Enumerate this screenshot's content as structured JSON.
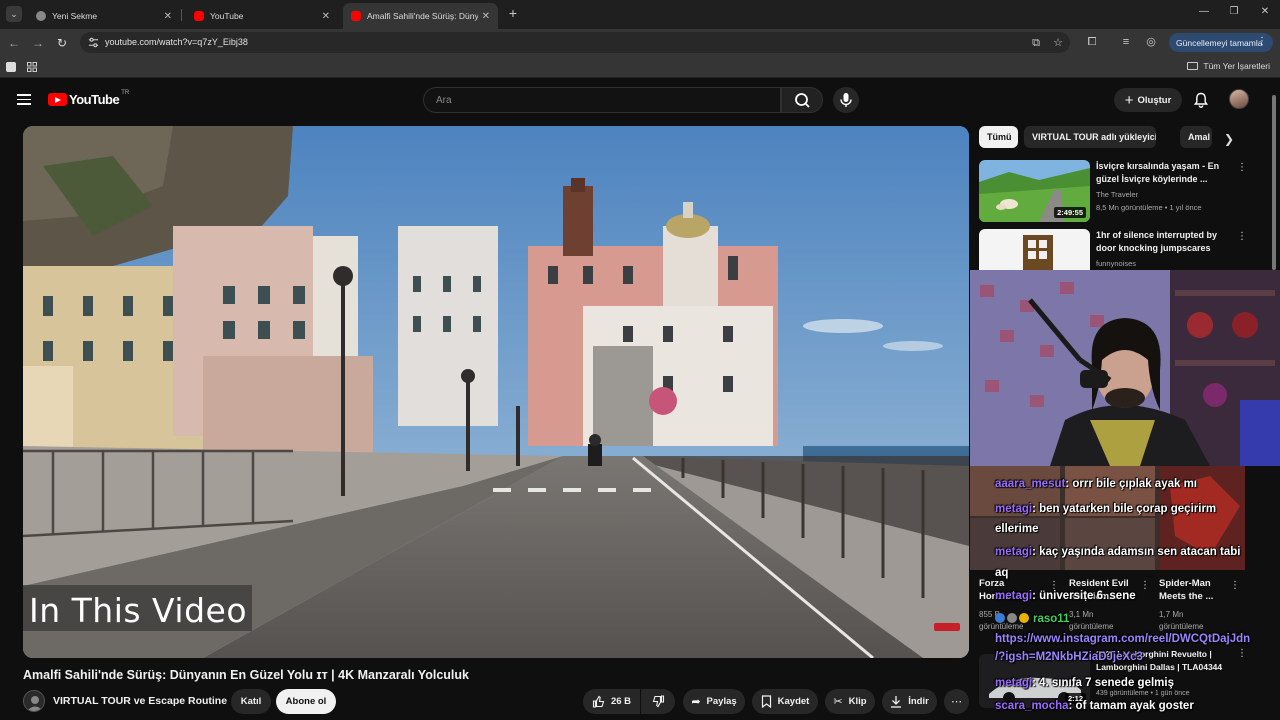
{
  "browser": {
    "tabs": [
      {
        "title": "Yeni Sekme",
        "active": false
      },
      {
        "title": "YouTube",
        "active": false
      },
      {
        "title": "Amalfi Sahili'nde Sürüş: Dünyan",
        "active": true
      }
    ],
    "url": "youtube.com/watch?v=q7zY_Eibj38",
    "update_button": "Güncellemeyi tamamla",
    "all_bookmarks": "Tüm Yer İşaretleri"
  },
  "yt_header": {
    "logo_text": "YouTube",
    "country_code": "TR",
    "search_placeholder": "Ara",
    "create_label": "Oluştur"
  },
  "player": {
    "overlay_text": "In This Video"
  },
  "video": {
    "title": "Amalfi Sahili'nde Sürüş: Dünyanın En Güzel Yolu ɪᴛ | 4K Manzaralı Yolculuk",
    "channel": "VIRTUAL TOUR ve Escape Routine",
    "join_label": "Katıl",
    "subscribe_label": "Abone ol",
    "like_count": "26 B",
    "share_label": "Paylaş",
    "save_label": "Kaydet",
    "clip_label": "Klip",
    "download_label": "İndir"
  },
  "sidebar": {
    "chips": [
      "Tümü",
      "VIRTUAL TOUR adlı yükleyiciden",
      "Amal"
    ],
    "recommendations": [
      {
        "title": "İsviçre kırsalında yaşam - En güzel İsviçre köylerinde ...",
        "channel": "The Traveler",
        "meta": "8,5 Mn görüntüleme • 1 yıl önce",
        "duration": "2:49:55"
      },
      {
        "title": "1hr of silence interrupted by door knocking jumpscares",
        "channel": "funnynoises",
        "meta": "",
        "duration": ""
      }
    ],
    "shorts": [
      {
        "title": "Forza Horiz...",
        "meta1": "855 B",
        "meta2": "görüntüleme"
      },
      {
        "title": "Resident Evil Requiem...",
        "meta1": "3,1 Mn",
        "meta2": "görüntüleme"
      },
      {
        "title": "Spider-Man Meets the ...",
        "meta1": "1,7 Mn",
        "meta2": "görüntüleme"
      }
    ],
    "bottom_rec": {
      "title": "2026 Lamborghini Revuelto | Lamborghini Dallas | TLA04344",
      "meta": "439 görüntüleme • 1 gün önce",
      "duration": "2:12"
    }
  },
  "stream_chat": [
    {
      "user": "aaara_mesut",
      "text": ": orrr bile çıplak ayak mı"
    },
    {
      "user": "metagi",
      "text": ": ben yatarken bile çorap geçirirm"
    },
    {
      "user": "",
      "text": "ellerime"
    },
    {
      "user": "metagi",
      "text": ": kaç yaşında adamsın sen atacan tabi"
    },
    {
      "user": "",
      "text": "aq"
    },
    {
      "user": "metagi",
      "text": ": üniversite 6. sene"
    },
    {
      "user": "",
      "text": "raso11"
    },
    {
      "user": "",
      "text": "https://www.instagram.com/reel/DWCQtDajJdn"
    },
    {
      "user": "",
      "text": "/?igsh=M2NkbHZiaDJjeXc3"
    },
    {
      "user": "metagi",
      "text": ": 4. sınıfa 7 senede gelmiş"
    },
    {
      "user": "scara_mocha",
      "text": ": of tamam ayak goster"
    }
  ],
  "colors": {
    "bg": "#0f0f0f",
    "chip": "#272727",
    "yt_red": "#ff0000",
    "chat_user": "#9b6bff",
    "update_btn": "#2d4a70"
  }
}
